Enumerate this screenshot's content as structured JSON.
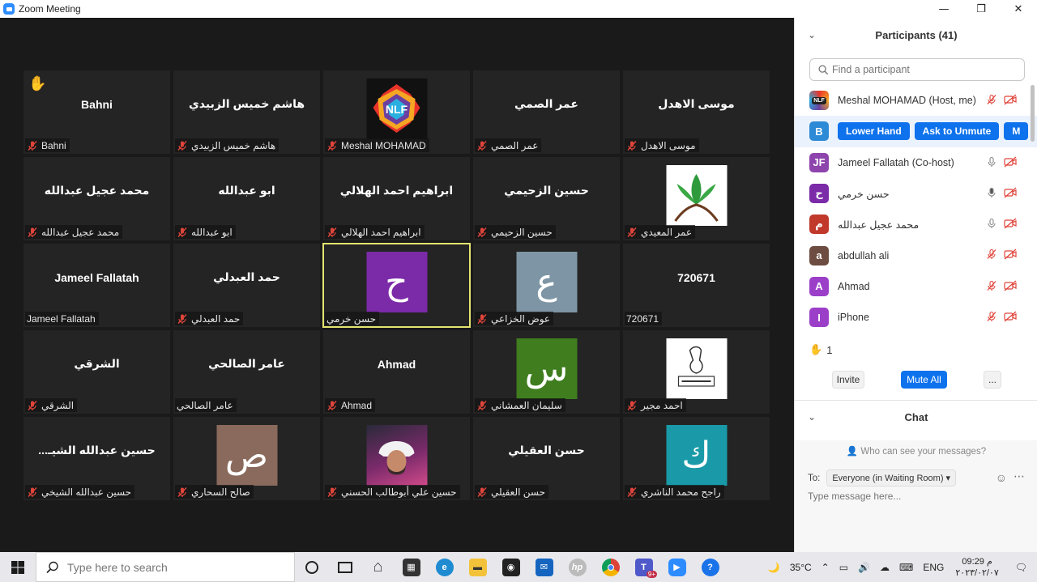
{
  "window": {
    "title": "Zoom Meeting",
    "minimize": "—",
    "restore": "❐",
    "close": "✕"
  },
  "tiles": [
    {
      "center": "Bahni",
      "label": "Bahni",
      "type": "name",
      "raised_hand": true
    },
    {
      "center": "هاشم خميس الزبيدي",
      "label": "هاشم خميس الزبيدي",
      "type": "name"
    },
    {
      "center": "NLF",
      "label": "Meshal MOHAMAD",
      "type": "logo"
    },
    {
      "center": "عمر الصمي",
      "label": "عمر الصمي",
      "type": "name"
    },
    {
      "center": "موسى الاهدل",
      "label": "موسى الاهدل",
      "type": "name"
    },
    {
      "center": "محمد عجيل عبدالله",
      "label": "محمد عجيل عبدالله",
      "type": "name"
    },
    {
      "center": "ابو عبدالله",
      "label": "ابو عبدالله",
      "type": "name"
    },
    {
      "center": "ابراهيم احمد الهلالي",
      "label": "ابراهيم احمد الهلالي",
      "type": "name"
    },
    {
      "center": "حسين الزحيمي",
      "label": "حسين الزحيمي",
      "type": "name"
    },
    {
      "center": "",
      "label": "عمر المعيدي",
      "type": "plant"
    },
    {
      "center": "Jameel Fallatah",
      "label": "Jameel Fallatah",
      "type": "name",
      "no_mic_icon": true
    },
    {
      "center": "حمد العبدلي",
      "label": "حمد العبدلي",
      "type": "name"
    },
    {
      "center": "ح",
      "label": "حسن خرمي",
      "type": "avatar",
      "color": "#7b2aa8",
      "active": true,
      "no_mic_icon": true
    },
    {
      "center": "ع",
      "label": "عوض الخزاعي",
      "type": "avatar",
      "color": "#7d95a4"
    },
    {
      "center": "720671",
      "label": "720671",
      "type": "name",
      "no_mic_icon": true
    },
    {
      "center": "الشرقي",
      "label": "الشرقي",
      "type": "name"
    },
    {
      "center": "عامر الصالحي",
      "label": "عامر الصالحي",
      "type": "name",
      "no_mic_icon": true
    },
    {
      "center": "Ahmad",
      "label": "Ahmad",
      "type": "name"
    },
    {
      "center": "س",
      "label": "سليمان العمشاني",
      "type": "avatar",
      "color": "#3f7d1e"
    },
    {
      "center": "",
      "label": "احمد مجير",
      "type": "sketch"
    },
    {
      "center": "...حسين عبدالله الشيـ",
      "label": "حسين عبدالله الشيخي",
      "type": "name"
    },
    {
      "center": "ص",
      "label": "صالح السحاري",
      "type": "avatar",
      "color": "#8a6a5c"
    },
    {
      "center": "",
      "label": "حسين علي أبوطالب الحسني",
      "type": "photo"
    },
    {
      "center": "حسن العقيلي",
      "label": "حسن العقيلي",
      "type": "name"
    },
    {
      "center": "ك",
      "label": "راجح محمد الناشري",
      "type": "avatar",
      "color": "#1a9aa8"
    }
  ],
  "panel": {
    "title": "Participants (41)",
    "search_placeholder": "Find a participant",
    "participants": [
      {
        "initial": "NLF",
        "name": "Meshal MOHAMAD (Host, me)",
        "color": "#2d2d2d",
        "mic": "off",
        "video": "off"
      },
      {
        "initial": "B",
        "name": "",
        "color": "#2d8ad6",
        "highlight": true,
        "buttons": [
          "Lower Hand",
          "Ask to Unmute",
          "M"
        ]
      },
      {
        "initial": "JF",
        "name": "Jameel Fallatah (Co-host)",
        "color": "#8e44ad",
        "mic": "on",
        "video": "off"
      },
      {
        "initial": "ح",
        "name": "حسن خرمي",
        "color": "#7b2aa8",
        "mic": "active",
        "video": "off"
      },
      {
        "initial": "م",
        "name": "محمد عجيل عبدالله",
        "color": "#c0392b",
        "mic": "on",
        "video": "off"
      },
      {
        "initial": "a",
        "name": "abdullah ali",
        "color": "#6d4c41",
        "mic": "off",
        "video": "off"
      },
      {
        "initial": "A",
        "name": "Ahmad",
        "color": "#9b3fc9",
        "mic": "off",
        "video": "off"
      },
      {
        "initial": "I",
        "name": "iPhone",
        "color": "#9b3fc9",
        "mic": "off",
        "video": "off"
      }
    ],
    "raised_count": "1",
    "invite": "Invite",
    "mute_all": "Mute All",
    "more": "...",
    "chat_title": "Chat",
    "who_can_see": "Who can see your messages?",
    "to_label": "To:",
    "to_value": "Everyone (in Waiting Room)",
    "message_placeholder": "Type message here..."
  },
  "taskbar": {
    "search_placeholder": "Type here to search",
    "weather": "35°C",
    "lang": "ENG",
    "time": "09:29 م",
    "date": "٢٠٢٣/٠٢/٠٧",
    "teams_badge": "9+"
  },
  "colors": {
    "accent": "#0e72ed",
    "muted_red": "#e0453b",
    "active_outline": "#e4e56f"
  }
}
